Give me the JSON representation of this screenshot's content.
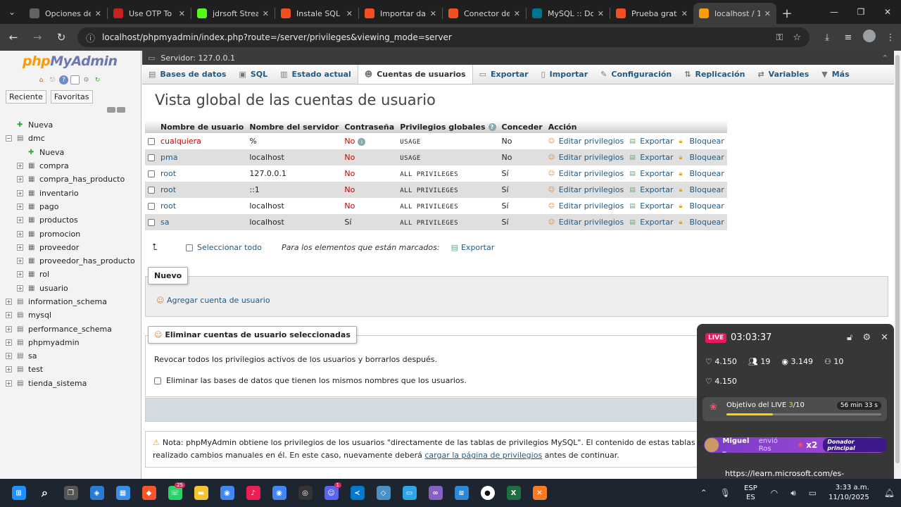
{
  "browser": {
    "tabs": [
      {
        "title": "Opciones de",
        "favicon": "gear-icon",
        "color": "#5f6368"
      },
      {
        "title": "Use OTP To F",
        "favicon": "gmail-icon",
        "color": "#c5221f"
      },
      {
        "title": "jdrsoft Strean",
        "favicon": "kick-icon",
        "color": "#53fc18"
      },
      {
        "title": "Instale SQL S",
        "favicon": "microsoft-icon",
        "color": "#f25022"
      },
      {
        "title": "Importar dat",
        "favicon": "microsoft-icon",
        "color": "#f25022"
      },
      {
        "title": "Conector de",
        "favicon": "microsoft-icon",
        "color": "#f25022"
      },
      {
        "title": "MySQL :: Dow",
        "favicon": "mysql-icon",
        "color": "#00758f"
      },
      {
        "title": "Prueba gratu",
        "favicon": "microsoft-icon",
        "color": "#f25022"
      },
      {
        "title": "localhost / 1",
        "favicon": "phpmyadmin-icon",
        "color": "#f89c0e",
        "active": true
      }
    ],
    "url": "localhost/phpmyadmin/index.php?route=/server/privileges&viewing_mode=server"
  },
  "nav_panel": {
    "logo_php": "php",
    "logo_my": "MyAdmin",
    "tab_recent": "Reciente",
    "tab_favorites": "Favoritas",
    "tree": [
      {
        "label": "Nueva",
        "level": 0,
        "expander": false,
        "icon": "new-db-icon"
      },
      {
        "label": "dmc",
        "level": 0,
        "expander": true,
        "expanded": true
      },
      {
        "label": "Nueva",
        "level": 1,
        "expander": false,
        "icon": "new-table-icon"
      },
      {
        "label": "compra",
        "level": 1,
        "expander": true
      },
      {
        "label": "compra_has_producto",
        "level": 1,
        "expander": true
      },
      {
        "label": "inventario",
        "level": 1,
        "expander": true
      },
      {
        "label": "pago",
        "level": 1,
        "expander": true
      },
      {
        "label": "productos",
        "level": 1,
        "expander": true
      },
      {
        "label": "promocion",
        "level": 1,
        "expander": true
      },
      {
        "label": "proveedor",
        "level": 1,
        "expander": true
      },
      {
        "label": "proveedor_has_producto",
        "level": 1,
        "expander": true
      },
      {
        "label": "rol",
        "level": 1,
        "expander": true
      },
      {
        "label": "usuario",
        "level": 1,
        "expander": true
      },
      {
        "label": "information_schema",
        "level": 0,
        "expander": true
      },
      {
        "label": "mysql",
        "level": 0,
        "expander": true
      },
      {
        "label": "performance_schema",
        "level": 0,
        "expander": true
      },
      {
        "label": "phpmyadmin",
        "level": 0,
        "expander": true
      },
      {
        "label": "sa",
        "level": 0,
        "expander": true
      },
      {
        "label": "test",
        "level": 0,
        "expander": true
      },
      {
        "label": "tienda_sistema",
        "level": 0,
        "expander": true
      }
    ]
  },
  "main": {
    "server_label": "Servidor: 127.0.0.1",
    "menu": [
      {
        "label": "Bases de datos",
        "icon": "database-icon"
      },
      {
        "label": "SQL",
        "icon": "sql-icon"
      },
      {
        "label": "Estado actual",
        "icon": "status-icon"
      },
      {
        "label": "Cuentas de usuarios",
        "icon": "users-icon",
        "active": true
      },
      {
        "label": "Exportar",
        "icon": "export-icon"
      },
      {
        "label": "Importar",
        "icon": "import-icon"
      },
      {
        "label": "Configuración",
        "icon": "wrench-icon"
      },
      {
        "label": "Replicación",
        "icon": "replication-icon"
      },
      {
        "label": "Variables",
        "icon": "variables-icon"
      },
      {
        "label": "Más",
        "icon": "chevron-down-icon"
      }
    ],
    "title": "Vista global de las cuentas de usuario",
    "table": {
      "headers": [
        "Nombre de usuario",
        "Nombre del servidor",
        "Contraseña",
        "Privilegios globales",
        "Conceder",
        "Acción"
      ],
      "rows": [
        {
          "user": "cualquiera",
          "host": "%",
          "password": "No",
          "privileges": "USAGE",
          "grant": "No"
        },
        {
          "user": "pma",
          "host": "localhost",
          "password": "No",
          "privileges": "USAGE",
          "grant": "No"
        },
        {
          "user": "root",
          "host": "127.0.0.1",
          "password": "No",
          "privileges": "ALL PRIVILEGES",
          "grant": "Sí"
        },
        {
          "user": "root",
          "host": "::1",
          "password": "No",
          "privileges": "ALL PRIVILEGES",
          "grant": "Sí"
        },
        {
          "user": "root",
          "host": "localhost",
          "password": "No",
          "privileges": "ALL PRIVILEGES",
          "grant": "Sí"
        },
        {
          "user": "sa",
          "host": "localhost",
          "password": "Sí",
          "privileges": "ALL PRIVILEGES",
          "grant": "Sí"
        }
      ],
      "actions": {
        "edit": "Editar privilegios",
        "export": "Exportar",
        "lock": "Bloquear"
      }
    },
    "with_selected": {
      "select_all": "Seleccionar todo",
      "marked": "Para los elementos que están marcados:",
      "export": "Exportar"
    },
    "new_section": {
      "legend": "Nuevo",
      "add_user": "Agregar cuenta de usuario"
    },
    "delete_section": {
      "legend": "Eliminar cuentas de usuario seleccionadas",
      "revoke_text": "Revocar todos los privilegios activos de los usuarios y borrarlos después.",
      "drop_db_text": "Eliminar las bases de datos que tienen los mismos nombres que los usuarios."
    },
    "note": {
      "part1": "Nota: phpMyAdmin obtiene los privilegios de los usuarios \"directamente de las tablas de privilegios MySQL\". El contenido de estas tablas puede diferir de los p",
      "part2": "realizado cambios manuales en él. En este caso, nuevamente deberá ",
      "link": "cargar la página de privilegios",
      "part3": " antes de continuar."
    }
  },
  "live_overlay": {
    "badge": "LIVE",
    "time": "03:03:37",
    "likes": "4.150",
    "followers": "19",
    "viewers": "3.149",
    "new_followers": "10",
    "likes2": "4.150",
    "goal_label": "Objetivo del LIVE",
    "goal_current": "3",
    "goal_total": "/10",
    "goal_progress": 0.3,
    "goal_timer": "56 min 33 s",
    "gift_user": "Miguel _",
    "gift_text": "envió Ros",
    "gift_mult": "x2",
    "gift_badge": "Donador principal",
    "url": "https://learn.microsoft.com/es-"
  },
  "taskbar": {
    "apps": [
      {
        "name": "windows-start-icon",
        "color": "#1e90ff"
      },
      {
        "name": "search-icon",
        "color": "#1c2530"
      },
      {
        "name": "task-view-icon",
        "color": "#555"
      },
      {
        "name": "copilot-icon",
        "color": "#2a7bd3"
      },
      {
        "name": "store-icon",
        "color": "#3a8ee6"
      },
      {
        "name": "brave-icon",
        "color": "#fb542b"
      },
      {
        "name": "whatsapp-icon",
        "color": "#25d366",
        "badge": "25"
      },
      {
        "name": "file-explorer-icon",
        "color": "#f4c430"
      },
      {
        "name": "chrome-icon",
        "color": "#4285f4"
      },
      {
        "name": "tiktok-icon",
        "color": "#ee1d52"
      },
      {
        "name": "chrome-profile-icon",
        "color": "#4285f4"
      },
      {
        "name": "obs-icon",
        "color": "#333"
      },
      {
        "name": "discord-icon",
        "color": "#5865f2",
        "badge": "1"
      },
      {
        "name": "vscode-icon",
        "color": "#007acc"
      },
      {
        "name": "workbench-icon",
        "color": "#4a90c2"
      },
      {
        "name": "monitor-icon",
        "color": "#2fa4e7"
      },
      {
        "name": "visual-studio-icon",
        "color": "#865fc5"
      },
      {
        "name": "azure-data-studio-icon",
        "color": "#2b88d8"
      },
      {
        "name": "github-icon",
        "color": "#ffffff"
      },
      {
        "name": "excel-icon",
        "color": "#1d6f42"
      },
      {
        "name": "xampp-icon",
        "color": "#fb7a24"
      }
    ],
    "lang_top": "ESP",
    "lang_bottom": "ES",
    "time": "3:33 a.m.",
    "date": "11/10/2025"
  }
}
